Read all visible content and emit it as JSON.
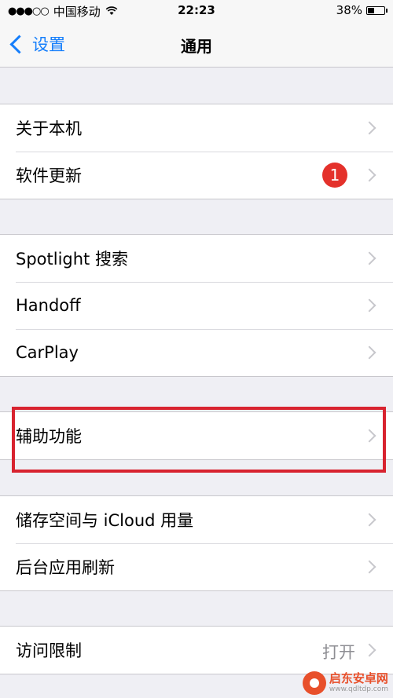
{
  "status_bar": {
    "signal": "●●●○○",
    "carrier": "中国移动",
    "time": "22:23",
    "battery": "38%",
    "battery_level": 0.38
  },
  "nav": {
    "back_label": "设置",
    "title": "通用"
  },
  "groups": [
    {
      "rows": [
        {
          "label": "关于本机"
        },
        {
          "label": "软件更新",
          "badge": "1"
        }
      ]
    },
    {
      "rows": [
        {
          "label": "Spotlight 搜索"
        },
        {
          "label": "Handoff"
        },
        {
          "label": "CarPlay"
        }
      ]
    },
    {
      "rows": [
        {
          "label": "辅助功能"
        }
      ]
    },
    {
      "rows": [
        {
          "label": "储存空间与 iCloud 用量"
        },
        {
          "label": "后台应用刷新"
        }
      ]
    },
    {
      "rows": [
        {
          "label": "访问限制",
          "detail": "打开"
        }
      ]
    }
  ],
  "watermark": {
    "name": "启东安卓网",
    "url": "www.qdltdp.com"
  },
  "colors": {
    "accent": "#157efb",
    "badge": "#e4312b",
    "highlight": "#d8232f",
    "background": "#efeff4"
  }
}
